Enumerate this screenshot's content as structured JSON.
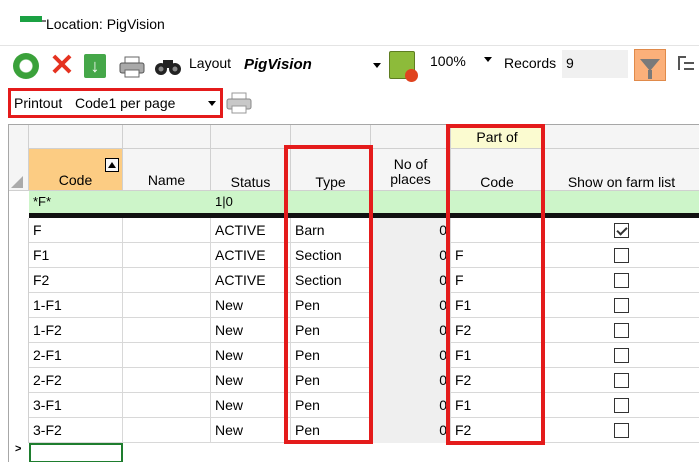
{
  "window": {
    "title": "Location: PigVision"
  },
  "toolbar": {
    "layout_label": "Layout",
    "layout_value": "PigVision",
    "zoom_value": "100%",
    "records_label": "Records",
    "records_value": "9",
    "icons": [
      "refresh-icon",
      "delete-icon",
      "export-icon",
      "print-icon",
      "binoculars-icon",
      "layout-edit-icon",
      "filter-icon",
      "tree-icon"
    ]
  },
  "printbar": {
    "printout_label": "Printout",
    "printout_value": "Code1 per page"
  },
  "grid": {
    "headers": {
      "code": "Code",
      "name": "Name",
      "status": "Status",
      "type": "Type",
      "places_line1": "No of",
      "places_line2": "places",
      "partof_group": "Part of",
      "partof_code": "Code",
      "farm": "Show on farm list"
    },
    "filter": {
      "code": "*F*",
      "status": "1|0"
    },
    "rows": [
      {
        "code": "F",
        "name": "",
        "status": "ACTIVE",
        "type": "Barn",
        "places": "0",
        "partof": "",
        "farm": true
      },
      {
        "code": "F1",
        "name": "",
        "status": "ACTIVE",
        "type": "Section",
        "places": "0",
        "partof": "F",
        "farm": false
      },
      {
        "code": "F2",
        "name": "",
        "status": "ACTIVE",
        "type": "Section",
        "places": "0",
        "partof": "F",
        "farm": false
      },
      {
        "code": "1-F1",
        "name": "",
        "status": "New",
        "type": "Pen",
        "places": "0",
        "partof": "F1",
        "farm": false
      },
      {
        "code": "1-F2",
        "name": "",
        "status": "New",
        "type": "Pen",
        "places": "0",
        "partof": "F2",
        "farm": false
      },
      {
        "code": "2-F1",
        "name": "",
        "status": "New",
        "type": "Pen",
        "places": "0",
        "partof": "F1",
        "farm": false
      },
      {
        "code": "2-F2",
        "name": "",
        "status": "New",
        "type": "Pen",
        "places": "0",
        "partof": "F2",
        "farm": false
      },
      {
        "code": "3-F1",
        "name": "",
        "status": "New",
        "type": "Pen",
        "places": "0",
        "partof": "F1",
        "farm": false
      },
      {
        "code": "3-F2",
        "name": "",
        "status": "New",
        "type": "Pen",
        "places": "0",
        "partof": "F2",
        "farm": false
      }
    ],
    "new_row_marker": ">"
  },
  "colors": {
    "highlight": "#e41b1b",
    "filter_row": "#cdf5c9",
    "sorted_header": "#fccc83",
    "group_header": "#fbfbd0"
  }
}
